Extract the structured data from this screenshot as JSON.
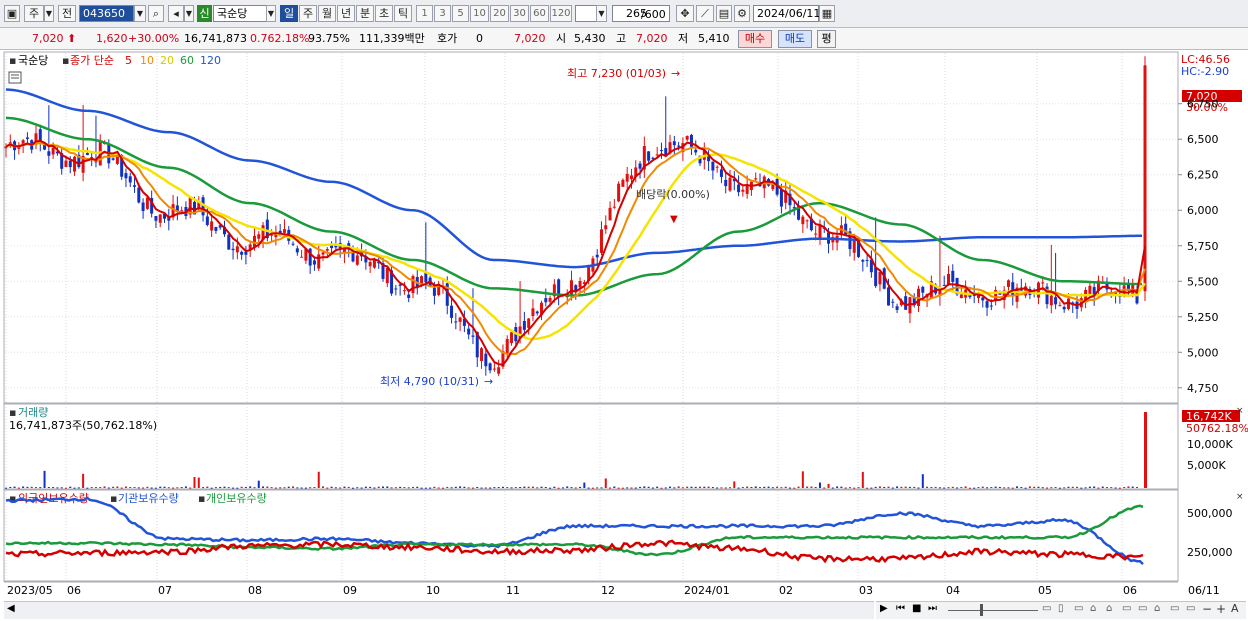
{
  "toolbar": {
    "period_week_short": "주",
    "prev_label": "전",
    "code": "043650",
    "new_badge": "신",
    "stock_name": "국순당",
    "timeframes": [
      "일",
      "주",
      "월",
      "년",
      "분",
      "초",
      "틱"
    ],
    "active_timeframe": "일",
    "intervals": [
      "1",
      "3",
      "5",
      "10",
      "20",
      "30",
      "60",
      "120"
    ],
    "count_value": "265",
    "count_total": "/600",
    "date": "2024/06/11"
  },
  "quote": {
    "price": "7,020",
    "change": "1,620",
    "change_pct": "+30.00%",
    "volume": "16,741,873",
    "volume_ratio": "0.762.18%",
    "turnover": "93.75%",
    "amount": "111,339백만",
    "bid_label": "호가",
    "bid_value": "0",
    "ask_value": "7,020",
    "open_label": "시",
    "open": "5,430",
    "high_label": "고",
    "high": "7,020",
    "low_label": "저",
    "low": "5,410",
    "buy_label": "매수",
    "sell_label": "매도",
    "flat_label": "평"
  },
  "price_panel": {
    "name": "국순당",
    "indicator": "종가 단순",
    "ma_periods": [
      "5",
      "10",
      "20",
      "60",
      "120"
    ],
    "lc": "LC:46.56",
    "hc": "HC:-2.90",
    "last_price": "7,020",
    "last_pct": "30.00%",
    "y_ticks": [
      "6,750",
      "6,500",
      "6,250",
      "6,000",
      "5,750",
      "5,500",
      "5,250",
      "5,000",
      "4,750"
    ],
    "annot_high": "최고 7,230 (01/03)",
    "annot_low": "최저 4,790 (10/31)",
    "annot_div": "배당락(0.00%)"
  },
  "volume_panel": {
    "title": "거래량",
    "value": "16,741,873주(50,762.18%)",
    "last": "16,742K",
    "last_pct": "50762.18%",
    "y_ticks": [
      "10,000K",
      "5,000K"
    ]
  },
  "holdings_panel": {
    "series": [
      "외국인보유수량",
      "기관보유수량",
      "개인보유수량"
    ],
    "y_ticks": [
      "500,000",
      "250,000"
    ]
  },
  "x_axis": [
    "2023/05",
    "06",
    "07",
    "08",
    "09",
    "10",
    "11",
    "12",
    "2024/01",
    "02",
    "03",
    "04",
    "05",
    "06",
    "06/11"
  ],
  "colors": {
    "ma5": "#d40000",
    "ma10": "#f08a00",
    "ma20": "#f5e300",
    "ma60": "#1a9a3a",
    "ma120": "#2154d8",
    "up": "#e01010",
    "down": "#1030c0"
  },
  "chart_data": {
    "type": "line",
    "x": [
      "2023/05",
      "2023/06",
      "2023/07",
      "2023/08",
      "2023/09",
      "2023/10",
      "2023/11",
      "2023/12",
      "2024/01",
      "2024/02",
      "2024/03",
      "2024/04",
      "2024/05",
      "2024/06",
      "2024/06/11"
    ],
    "series": [
      {
        "name": "종가",
        "values": [
          6450,
          6400,
          6000,
          5800,
          5700,
          5500,
          5000,
          5550,
          6500,
          6200,
          5900,
          5400,
          5450,
          5400,
          7020
        ]
      },
      {
        "name": "120",
        "values": [
          6850,
          6700,
          6550,
          6350,
          6200,
          6000,
          5650,
          5600,
          5700,
          5750,
          5800,
          5780,
          5810,
          5810,
          5820
        ]
      },
      {
        "name": "60",
        "values": [
          6650,
          6500,
          6300,
          6050,
          5850,
          5650,
          5450,
          5400,
          5550,
          5850,
          6050,
          5900,
          5650,
          5500,
          5480
        ]
      }
    ],
    "ylabel": "",
    "ylim": [
      4650,
      7100
    ],
    "high": {
      "value": 7230,
      "date": "01/03"
    },
    "low": {
      "value": 4790,
      "date": "10/31"
    }
  },
  "holdings_data": {
    "foreign": [
      560000,
      570000,
      290000,
      280000,
      290000,
      260000,
      240000,
      380000,
      380000,
      380000,
      380000,
      470000,
      380000,
      420000,
      120000
    ],
    "institution": [
      180000,
      190000,
      200000,
      240000,
      250000,
      230000,
      200000,
      210000,
      260000,
      220000,
      150000,
      150000,
      200000,
      180000,
      160000
    ],
    "individual": [
      260000,
      260000,
      250000,
      230000,
      220000,
      250000,
      250000,
      250000,
      180000,
      300000,
      300000,
      300000,
      300000,
      300000,
      520000
    ]
  }
}
